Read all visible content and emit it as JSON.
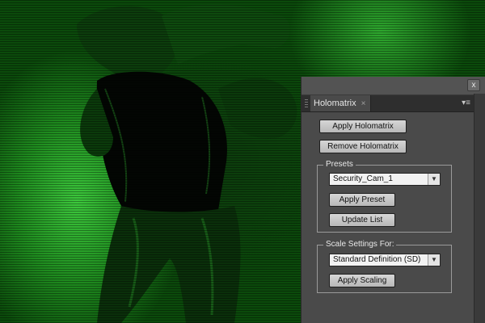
{
  "panel": {
    "close_icon": "x",
    "tab_title": "Holomatrix",
    "tab_close": "×",
    "menu_icon": "▾≡",
    "apply_button": "Apply Holomatrix",
    "remove_button": "Remove Holomatrix",
    "presets": {
      "legend": "Presets",
      "selected": "Security_Cam_1",
      "apply_preset": "Apply Preset",
      "update_list": "Update List"
    },
    "scale": {
      "legend": "Scale Settings For:",
      "selected": "Standard Definition (SD)",
      "apply_scaling": "Apply Scaling"
    }
  },
  "colors": {
    "photo_tint": "#1e8a1e",
    "panel_bg": "#4a4a4a",
    "button_bg": "#c8c8c8"
  }
}
